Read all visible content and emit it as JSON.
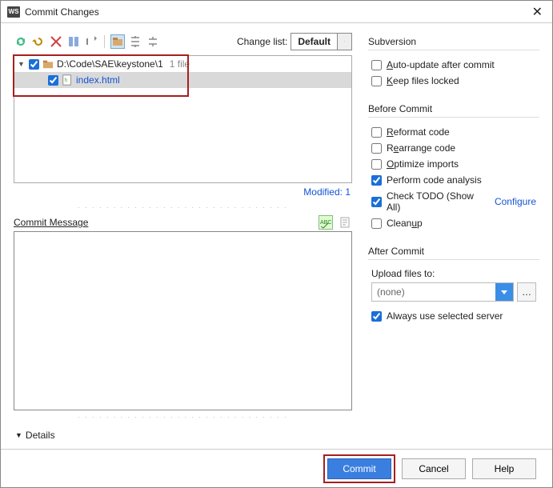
{
  "title": "Commit Changes",
  "toolbar": {
    "changelist_label": "Change list:",
    "changelist_value": "Default"
  },
  "tree": {
    "root_path": "D:\\Code\\SAE\\keystone\\1",
    "root_info": "1 file",
    "file_name": "index.html",
    "modified_label": "Modified: 1"
  },
  "commit_message": {
    "label": "Commit Message",
    "value": ""
  },
  "details_label": "Details",
  "subversion": {
    "title": "Subversion",
    "auto_update": "Auto-update after commit",
    "keep_locked": "Keep files locked"
  },
  "before_commit": {
    "title": "Before Commit",
    "reformat": "Reformat code",
    "rearrange": "Rearrange code",
    "optimize": "Optimize imports",
    "analysis": "Perform code analysis",
    "todo": "Check TODO (Show All)",
    "configure": "Configure",
    "cleanup": "Cleanup"
  },
  "after_commit": {
    "title": "After Commit",
    "upload_label": "Upload files to:",
    "upload_value": "(none)",
    "always_use": "Always use selected server"
  },
  "buttons": {
    "commit": "Commit",
    "cancel": "Cancel",
    "help": "Help"
  }
}
